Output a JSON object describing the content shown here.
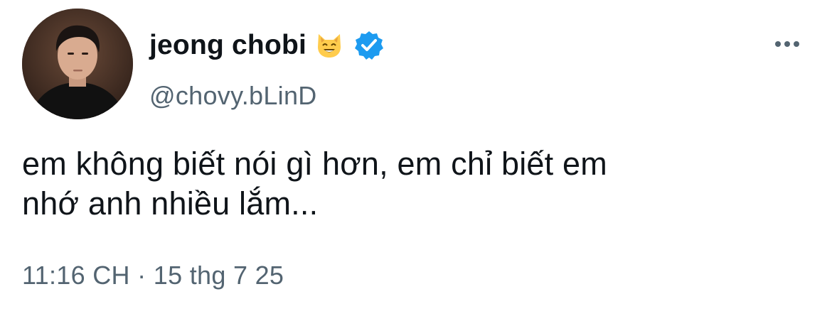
{
  "tweet": {
    "author": {
      "display_name": "jeong chobi",
      "handle": "@chovy.bLinD",
      "name_emoji": "cat-face-emoji",
      "verified_icon": "verified-badge-icon",
      "avatar": "profile-photo"
    },
    "more_icon": "more-options-icon",
    "text_lines": [
      "em không biết nói gì hơn, em chỉ biết em",
      "nhớ anh nhiều lắm..."
    ],
    "timestamp": {
      "time": "11:16 CH",
      "separator": "·",
      "date": "15 thg 7 25"
    }
  },
  "colors": {
    "background": "#ffffff",
    "primary_text": "#0f1419",
    "secondary_text": "#536471",
    "verified_blue": "#1d9bf0",
    "emoji_yellow": "#ffcc4d"
  }
}
